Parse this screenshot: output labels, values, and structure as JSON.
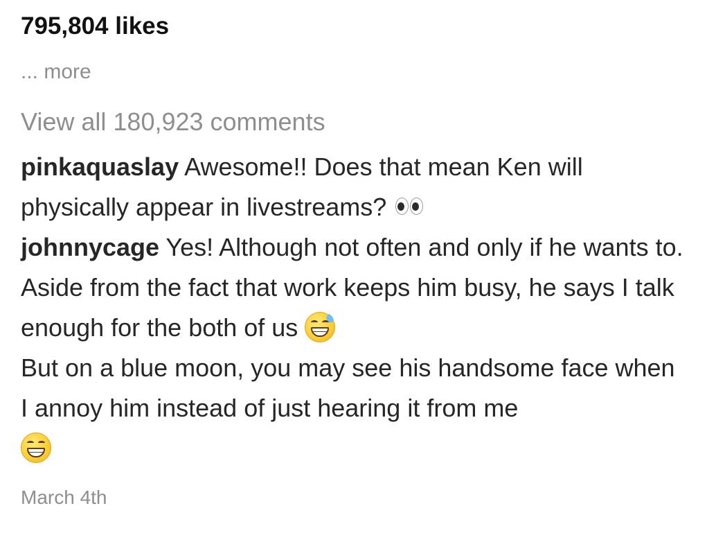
{
  "post": {
    "likes": "795,804 likes",
    "more": "... more",
    "view_all_comments": "View all 180,923 comments",
    "date": "March 4th"
  },
  "comments": [
    {
      "username": "pinkaquaslay",
      "text": " Awesome!! Does that mean Ken will physically appear in livestreams? ",
      "emoji": "eyes-emoji"
    },
    {
      "username": "johnnycage",
      "text": " Yes! Although not often and only if he wants to. Aside from the fact that work keeps him busy, he says I talk enough for the both of us ",
      "emoji": "grinning-face-with-sweat-emoji",
      "text2": "But on a blue moon, you may see his handsome face when I annoy him instead of just hearing it from me",
      "emoji2": "beaming-face-emoji"
    }
  ]
}
